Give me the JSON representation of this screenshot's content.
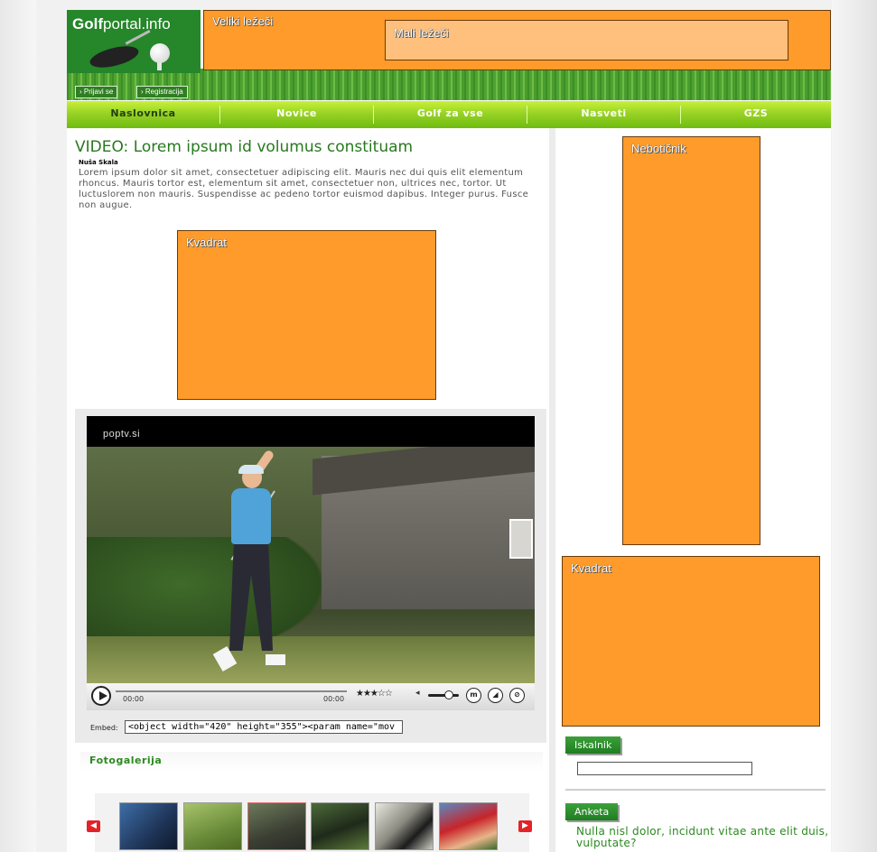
{
  "header": {
    "logo_bold": "Golf",
    "logo_rest": "portal.info",
    "login_label": "› Prijavi se",
    "register_label": "› Registracija",
    "ad_wide_label": "Veliki ležeči",
    "ad_small_label": "Mali ležeči"
  },
  "nav": {
    "items": [
      {
        "label": "Naslovnica",
        "active": true
      },
      {
        "label": "Novice"
      },
      {
        "label": "Golf za vse"
      },
      {
        "label": "Nasveti"
      },
      {
        "label": "GZS"
      }
    ]
  },
  "article": {
    "title": "VIDEO: Lorem ipsum id volumus constituam",
    "author": "Nuša Skala",
    "body": "Lorem ipsum dolor sit amet, consectetuer adipiscing elit. Mauris nec dui quis elit elementum rhoncus. Mauris tortor est, elementum sit amet, consectetuer non, ultrices nec, tortor. Ut luctuslorem non mauris. Suspendisse ac pedeno tortor euismod dapibus. Integer purus. Fusce non augue.",
    "ad_square_label": "Kvadrat"
  },
  "video": {
    "brand": "poptv.si",
    "time_current": "00:00",
    "time_total": "00:00",
    "rating_text": "★★★☆☆",
    "rating": 3,
    "rating_max": 5,
    "btn_m": "m",
    "btn_share": "◢",
    "btn_link": "⊘",
    "vol_icon": "◂"
  },
  "embed": {
    "label": "Embed:",
    "value": "<object width=\"420\" height=\"355\"><param name=\"mov"
  },
  "gallery": {
    "title": "Fotogalerija",
    "prev": "◀",
    "next": "▶"
  },
  "sidebar": {
    "ad_tall_label": "Nebotičnik",
    "ad_square_label": "Kvadrat",
    "search_tab": "Iskalnik",
    "poll_tab": "Anketa",
    "poll_question": "Nulla nisl dolor, incidunt vitae ante elit duis, vulputate?"
  },
  "colors": {
    "brand_green": "#25862a",
    "nav_green": "#98d326",
    "ad_orange": "#fe9b2a",
    "title_green": "#27791e"
  }
}
